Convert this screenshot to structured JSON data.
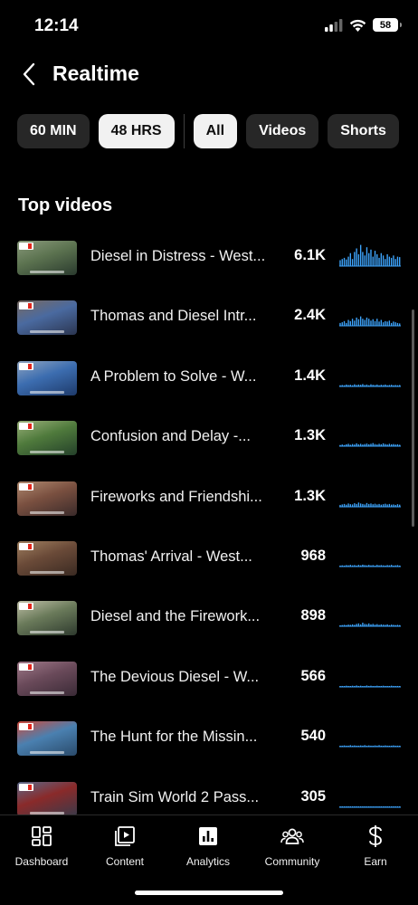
{
  "status": {
    "time": "12:14",
    "battery": "58"
  },
  "header": {
    "title": "Realtime"
  },
  "filters": {
    "time_ranges": [
      {
        "label": "60 MIN",
        "selected": false
      },
      {
        "label": "48 HRS",
        "selected": true
      }
    ],
    "types": [
      {
        "label": "All",
        "selected": true
      },
      {
        "label": "Videos",
        "selected": false
      },
      {
        "label": "Shorts",
        "selected": false
      }
    ]
  },
  "section": {
    "title": "Top videos"
  },
  "videos": [
    {
      "title": "Diesel in Distress - West...",
      "views": "6.1K",
      "thumb_colors": [
        "#2a3a2e",
        "#5c7350",
        "#8a9a7c"
      ],
      "activity": [
        0.25,
        0.3,
        0.35,
        0.28,
        0.4,
        0.55,
        0.3,
        0.6,
        0.75,
        0.5,
        0.9,
        0.6,
        0.45,
        0.8,
        0.55,
        0.7,
        0.4,
        0.65,
        0.5,
        0.35,
        0.55,
        0.45,
        0.3,
        0.5,
        0.4,
        0.35,
        0.45,
        0.3,
        0.4,
        0.38
      ]
    },
    {
      "title": "Thomas and Diesel Intr...",
      "views": "2.4K",
      "thumb_colors": [
        "#2b3550",
        "#4a6aa0",
        "#7a6a60"
      ],
      "activity": [
        0.12,
        0.15,
        0.2,
        0.12,
        0.25,
        0.2,
        0.3,
        0.22,
        0.35,
        0.28,
        0.4,
        0.3,
        0.25,
        0.35,
        0.3,
        0.22,
        0.28,
        0.2,
        0.3,
        0.18,
        0.25,
        0.15,
        0.2,
        0.18,
        0.22,
        0.12,
        0.18,
        0.15,
        0.12,
        0.1
      ]
    },
    {
      "title": "A Problem to Solve - W...",
      "views": "1.4K",
      "thumb_colors": [
        "#1e3a6a",
        "#3c6db0",
        "#8fa4c0"
      ],
      "activity": [
        0.05,
        0.06,
        0.05,
        0.08,
        0.06,
        0.07,
        0.05,
        0.09,
        0.06,
        0.08,
        0.07,
        0.1,
        0.06,
        0.08,
        0.05,
        0.09,
        0.07,
        0.06,
        0.08,
        0.05,
        0.07,
        0.06,
        0.08,
        0.05,
        0.06,
        0.07,
        0.05,
        0.06,
        0.05,
        0.06
      ]
    },
    {
      "title": "Confusion and Delay -...",
      "views": "1.3K",
      "thumb_colors": [
        "#24402a",
        "#4f7a3c",
        "#9ab07a"
      ],
      "activity": [
        0.05,
        0.07,
        0.05,
        0.08,
        0.1,
        0.06,
        0.09,
        0.07,
        0.12,
        0.08,
        0.1,
        0.07,
        0.09,
        0.11,
        0.08,
        0.1,
        0.13,
        0.09,
        0.07,
        0.1,
        0.08,
        0.12,
        0.09,
        0.07,
        0.1,
        0.08,
        0.09,
        0.07,
        0.08,
        0.06
      ]
    },
    {
      "title": "Fireworks and Friendshi...",
      "views": "1.3K",
      "thumb_colors": [
        "#3a2a2a",
        "#7a5040",
        "#b08a70"
      ],
      "activity": [
        0.08,
        0.1,
        0.12,
        0.09,
        0.14,
        0.11,
        0.1,
        0.15,
        0.12,
        0.18,
        0.14,
        0.12,
        0.1,
        0.16,
        0.12,
        0.14,
        0.11,
        0.13,
        0.1,
        0.12,
        0.09,
        0.11,
        0.13,
        0.1,
        0.12,
        0.09,
        0.1,
        0.08,
        0.11,
        0.09
      ]
    },
    {
      "title": "Thomas' Arrival - West...",
      "views": "968",
      "thumb_colors": [
        "#3a2a22",
        "#6a4a38",
        "#a08060"
      ],
      "activity": [
        0.04,
        0.05,
        0.04,
        0.06,
        0.05,
        0.07,
        0.05,
        0.06,
        0.04,
        0.07,
        0.05,
        0.08,
        0.06,
        0.05,
        0.07,
        0.05,
        0.06,
        0.04,
        0.07,
        0.05,
        0.06,
        0.05,
        0.04,
        0.06,
        0.05,
        0.07,
        0.04,
        0.05,
        0.06,
        0.04
      ]
    },
    {
      "title": "Diesel and the Firework...",
      "views": "898",
      "thumb_colors": [
        "#2e3a2e",
        "#6a7a5a",
        "#c0c0a8"
      ],
      "activity": [
        0.04,
        0.05,
        0.06,
        0.05,
        0.07,
        0.06,
        0.08,
        0.06,
        0.1,
        0.12,
        0.08,
        0.15,
        0.1,
        0.09,
        0.12,
        0.08,
        0.1,
        0.07,
        0.09,
        0.06,
        0.08,
        0.07,
        0.06,
        0.08,
        0.05,
        0.07,
        0.06,
        0.05,
        0.06,
        0.05
      ]
    },
    {
      "title": "The Devious Diesel - W...",
      "views": "566",
      "thumb_colors": [
        "#3a2a36",
        "#6a4a5a",
        "#a07a8a"
      ],
      "activity": [
        0.03,
        0.04,
        0.03,
        0.05,
        0.04,
        0.03,
        0.05,
        0.04,
        0.06,
        0.04,
        0.05,
        0.03,
        0.04,
        0.06,
        0.04,
        0.05,
        0.03,
        0.04,
        0.05,
        0.03,
        0.04,
        0.05,
        0.03,
        0.04,
        0.03,
        0.05,
        0.04,
        0.03,
        0.04,
        0.03
      ]
    },
    {
      "title": "The Hunt for the Missin...",
      "views": "540",
      "thumb_colors": [
        "#2a4a6a",
        "#4a80b0",
        "#d04a3a"
      ],
      "activity": [
        0.03,
        0.04,
        0.05,
        0.03,
        0.04,
        0.06,
        0.04,
        0.05,
        0.03,
        0.04,
        0.05,
        0.04,
        0.06,
        0.03,
        0.05,
        0.04,
        0.03,
        0.05,
        0.04,
        0.06,
        0.04,
        0.03,
        0.05,
        0.04,
        0.03,
        0.04,
        0.05,
        0.03,
        0.04,
        0.03
      ]
    },
    {
      "title": "Train Sim World 2 Pass...",
      "views": "305",
      "thumb_colors": [
        "#3a3a4a",
        "#8a2a2a",
        "#5a6a8a"
      ],
      "activity": [
        0.02,
        0.03,
        0.02,
        0.03,
        0.04,
        0.02,
        0.03,
        0.02,
        0.04,
        0.03,
        0.02,
        0.03,
        0.04,
        0.02,
        0.03,
        0.02,
        0.03,
        0.04,
        0.02,
        0.03,
        0.02,
        0.04,
        0.03,
        0.02,
        0.03,
        0.02,
        0.03,
        0.02,
        0.03,
        0.02
      ]
    }
  ],
  "nav": [
    {
      "label": "Dashboard",
      "icon": "dashboard-icon"
    },
    {
      "label": "Content",
      "icon": "content-icon"
    },
    {
      "label": "Analytics",
      "icon": "analytics-icon",
      "selected": true
    },
    {
      "label": "Community",
      "icon": "community-icon"
    },
    {
      "label": "Earn",
      "icon": "earn-icon"
    }
  ],
  "colors": {
    "spark": "#3ea6ff",
    "chip_bg": "#272727",
    "chip_active_bg": "#f1f1f1"
  }
}
